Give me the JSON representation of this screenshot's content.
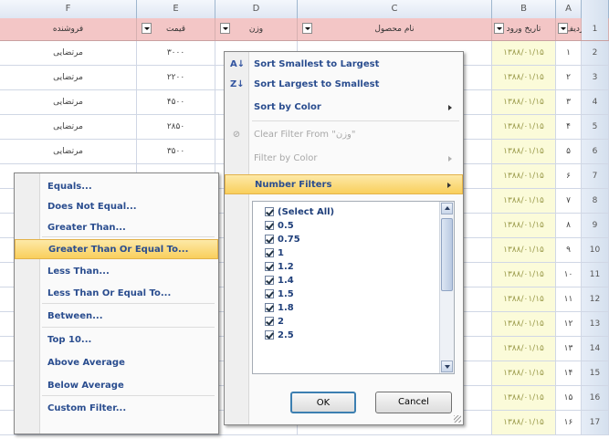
{
  "sheet": {
    "col_headers": [
      "F",
      "E",
      "D",
      "C",
      "B",
      "A",
      ""
    ],
    "header_row": {
      "f": "فروشنده",
      "e": "قیمت",
      "d": "وزن",
      "c": "نام محصول",
      "b": "تاریخ ورود",
      "a": "ردیف",
      "num": "1"
    },
    "rows": [
      {
        "f": "مرتضایی",
        "e": "۳۰۰۰",
        "b": "۱۳۸۸/۰۱/۱۵",
        "a": "۱",
        "n": "2"
      },
      {
        "f": "مرتضایی",
        "e": "۲۲۰۰",
        "b": "۱۳۸۸/۰۱/۱۵",
        "a": "۲",
        "n": "3"
      },
      {
        "f": "مرتضایی",
        "e": "۴۵۰۰",
        "b": "۱۳۸۸/۰۱/۱۵",
        "a": "۳",
        "n": "4"
      },
      {
        "f": "مرتضایی",
        "e": "۲۸۵۰",
        "b": "۱۳۸۸/۰۱/۱۵",
        "a": "۴",
        "n": "5"
      },
      {
        "f": "مرتضایی",
        "e": "۳۵۰۰",
        "b": "۱۳۸۸/۰۱/۱۵",
        "a": "۵",
        "n": "6"
      },
      {
        "f": "",
        "e": "",
        "b": "۱۳۸۸/۰۱/۱۵",
        "a": "۶",
        "n": "7"
      },
      {
        "f": "",
        "e": "",
        "b": "۱۳۸۸/۰۱/۱۵",
        "a": "۷",
        "n": "8"
      },
      {
        "f": "",
        "e": "",
        "b": "۱۳۸۸/۰۱/۱۵",
        "a": "۸",
        "n": "9"
      },
      {
        "f": "",
        "e": "",
        "b": "۱۳۸۸/۰۱/۱۵",
        "a": "۹",
        "n": "10"
      },
      {
        "f": "",
        "e": "",
        "b": "۱۳۸۸/۰۱/۱۵",
        "a": "۱۰",
        "n": "11"
      },
      {
        "f": "",
        "e": "",
        "b": "۱۳۸۸/۰۱/۱۵",
        "a": "۱۱",
        "n": "12"
      },
      {
        "f": "",
        "e": "",
        "b": "۱۳۸۸/۰۱/۱۵",
        "a": "۱۲",
        "n": "13"
      },
      {
        "f": "",
        "e": "",
        "b": "۱۳۸۸/۰۱/۱۵",
        "a": "۱۳",
        "n": "14"
      },
      {
        "f": "",
        "e": "",
        "b": "۱۳۸۸/۰۱/۱۵",
        "a": "۱۴",
        "n": "15"
      },
      {
        "f": "",
        "e": "",
        "b": "۱۳۸۸/۰۱/۱۵",
        "a": "۱۵",
        "n": "16"
      },
      {
        "f": "",
        "e": "",
        "b": "۱۳۸۸/۰۱/۱۵",
        "a": "۱۶",
        "n": "17"
      }
    ]
  },
  "filter_menu": {
    "sort_asc": "Sort Smallest to Largest",
    "sort_desc": "Sort Largest to Smallest",
    "sort_color": "Sort by Color",
    "clear_filter": "Clear Filter From \"وزن\"",
    "filter_color": "Filter by Color",
    "number_filters": "Number Filters",
    "values": [
      "(Select All)",
      "0.5",
      "0.75",
      "1",
      "1.2",
      "1.4",
      "1.5",
      "1.8",
      "2",
      "2.5"
    ],
    "ok": "OK",
    "cancel": "Cancel"
  },
  "number_filters_menu": {
    "items": [
      "Equals...",
      "Does Not Equal...",
      "Greater Than...",
      "Greater Than Or Equal To...",
      "Less Than...",
      "Less Than Or Equal To...",
      "Between...",
      "Top 10...",
      "Above Average",
      "Below Average",
      "Custom Filter..."
    ],
    "highlighted": "Greater Than Or Equal To..."
  },
  "colors": {
    "header_row_bg": "#f3c6c6",
    "highlight": "#f9cf5c",
    "menu_text": "#2a4d8f",
    "date_cell_bg": "#fbfbd9"
  }
}
